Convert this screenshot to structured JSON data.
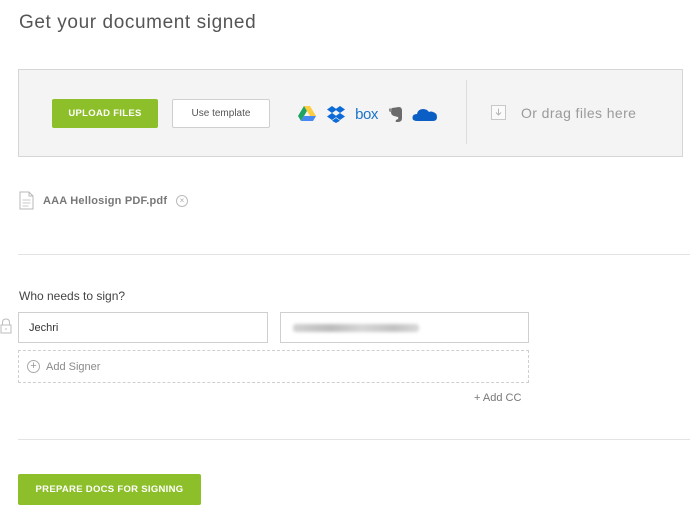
{
  "page": {
    "title": "Get your document signed"
  },
  "upload": {
    "upload_label": "UPLOAD FILES",
    "template_label": "Use template",
    "drag_text": "Or drag files here",
    "services": [
      {
        "name": "google-drive-icon",
        "colors": [
          "#1fa463",
          "#ffcd40",
          "#4688f4"
        ]
      },
      {
        "name": "dropbox-icon",
        "color": "#0d6ad6"
      },
      {
        "name": "box-icon",
        "label": "box",
        "color": "#1b74c8"
      },
      {
        "name": "evernote-icon",
        "color": "#6b6b6b"
      },
      {
        "name": "onedrive-icon",
        "color": "#0b5fc4"
      }
    ]
  },
  "file": {
    "name": "AAA Hellosign PDF.pdf",
    "remove_symbol": "×"
  },
  "signers": {
    "heading": "Who needs to sign?",
    "name_value": "Jechri",
    "add_signer_symbol": "+",
    "add_signer_label": "Add Signer",
    "add_cc_label": "+ Add CC"
  },
  "actions": {
    "prepare_label": "PREPARE DOCS FOR SIGNING"
  },
  "colors": {
    "accent": "#8dbf2a"
  }
}
